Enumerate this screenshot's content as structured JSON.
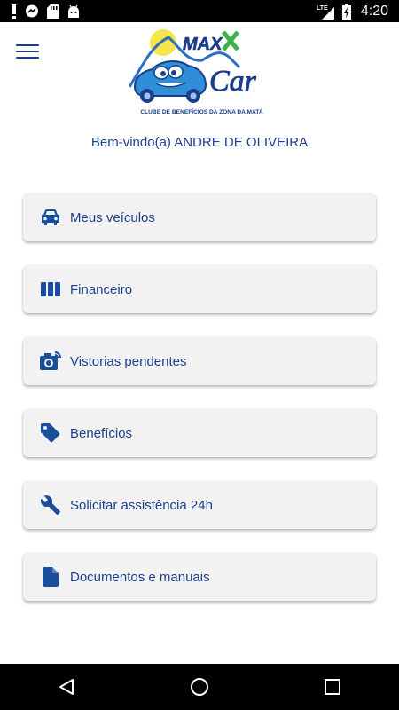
{
  "status_bar": {
    "time": "4:20",
    "network": "LTE",
    "icons": [
      "alert-icon",
      "messenger-icon",
      "sdcard-icon",
      "android-icon",
      "signal-icon",
      "battery-charging-icon"
    ]
  },
  "header": {
    "logo_brand_top": "MAX",
    "logo_brand_bottom": "Car",
    "logo_tagline": "CLUBE DE BENEFÍCIOS DA ZONA DA MATA"
  },
  "welcome_text": "Bem-vindo(a) ANDRE DE OLIVEIRA",
  "menu": {
    "items": [
      {
        "label": "Meus veículos",
        "icon": "car-icon"
      },
      {
        "label": "Financeiro",
        "icon": "bars-icon"
      },
      {
        "label": "Vistorias pendentes",
        "icon": "camera-icon"
      },
      {
        "label": "Benefícios",
        "icon": "tag-icon"
      },
      {
        "label": "Solicitar assistência 24h",
        "icon": "wrench-icon"
      },
      {
        "label": "Documentos e manuais",
        "icon": "document-icon"
      }
    ]
  },
  "colors": {
    "accent": "#1f3f8f",
    "card_bg": "#f2f2f2",
    "icon_blue": "#1a4f9c",
    "logo_green": "#3bb34a",
    "logo_sun": "#f5e44a",
    "logo_car": "#2f8fd6"
  },
  "nav_bar": {
    "buttons": [
      "back-icon",
      "home-icon",
      "recents-icon"
    ]
  }
}
